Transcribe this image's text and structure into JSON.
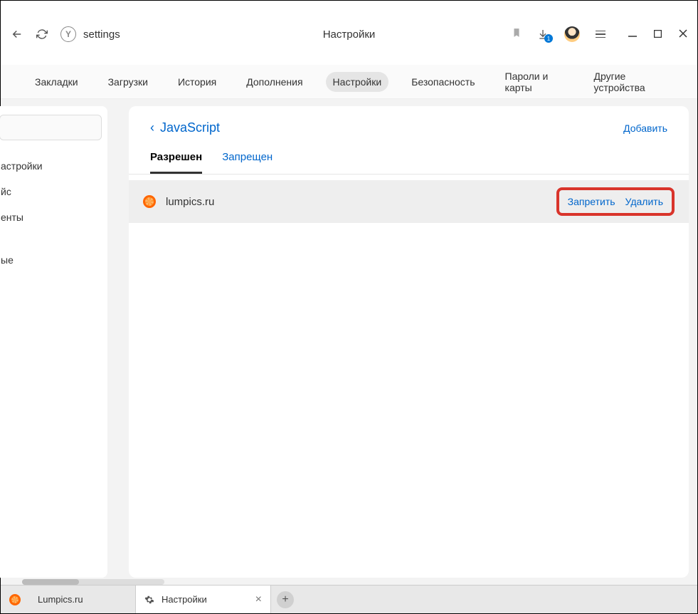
{
  "toolbar": {
    "address_text": "settings",
    "page_title": "Настройки",
    "download_badge": "1"
  },
  "nav": {
    "items": [
      "Закладки",
      "Загрузки",
      "История",
      "Дополнения",
      "Настройки",
      "Безопасность",
      "Пароли и карты",
      "Другие устройства"
    ],
    "active_index": 4
  },
  "sidebar": {
    "items": [
      "астройки",
      "йс",
      "енты",
      "ые"
    ]
  },
  "card": {
    "back_label": "JavaScript",
    "add_label": "Добавить",
    "tabs": [
      "Разрешен",
      "Запрещен"
    ],
    "active_tab_index": 0
  },
  "site": {
    "name": "lumpics.ru",
    "action_block": "Запретить",
    "action_delete": "Удалить"
  },
  "bottom_tabs": [
    {
      "label": "Lumpics.ru",
      "icon": "lumpics"
    },
    {
      "label": "Настройки",
      "icon": "gear"
    }
  ]
}
